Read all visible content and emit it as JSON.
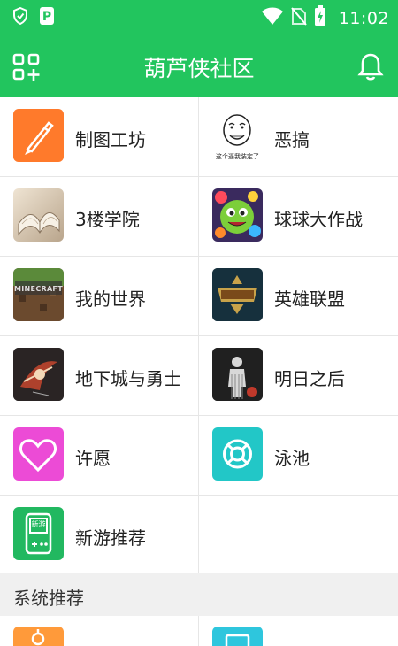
{
  "status_bar": {
    "time": "11:02",
    "icons": [
      "shield-icon",
      "p-app-icon",
      "wifi-icon",
      "no-sim-icon",
      "battery-charging-icon"
    ]
  },
  "header": {
    "title": "葫芦侠社区",
    "left_icon": "grid-add-icon",
    "right_icon": "bell-icon"
  },
  "forums": [
    {
      "label": "制图工坊",
      "icon": "brush-icon",
      "color": "#ff7a2b"
    },
    {
      "label": "恶搞",
      "icon": "meme-face-icon",
      "caption": "这个逼我装定了",
      "color": "#ffffff"
    },
    {
      "label": "3楼学院",
      "icon": "book-icon",
      "color": "#d9cbb8"
    },
    {
      "label": "球球大作战",
      "icon": "ball-battle-icon",
      "color": "#7ccf3a"
    },
    {
      "label": "我的世界",
      "icon": "minecraft-icon",
      "logo": "MINECRAFT",
      "color": "#5b8a3a"
    },
    {
      "label": "英雄联盟",
      "icon": "lol-icon",
      "color": "#1c3a4a"
    },
    {
      "label": "地下城与勇士",
      "icon": "dnf-icon",
      "color": "#2b2b2b"
    },
    {
      "label": "明日之后",
      "icon": "lifeafter-icon",
      "color": "#1a1a1a"
    },
    {
      "label": "许愿",
      "icon": "heart-icon",
      "color": "#ec4bd6"
    },
    {
      "label": "泳池",
      "icon": "lifebuoy-icon",
      "color": "#22c7c7"
    },
    {
      "label": "新游推荐",
      "icon": "gamepad-new-icon",
      "badge": "新游",
      "color": "#22b860"
    }
  ],
  "section": {
    "title": "系统推荐"
  },
  "peek_tiles": [
    {
      "icon": "orange-tile-icon",
      "color": "#ff9a3a"
    },
    {
      "icon": "cyan-tile-icon",
      "color": "#2ec6dd"
    }
  ]
}
